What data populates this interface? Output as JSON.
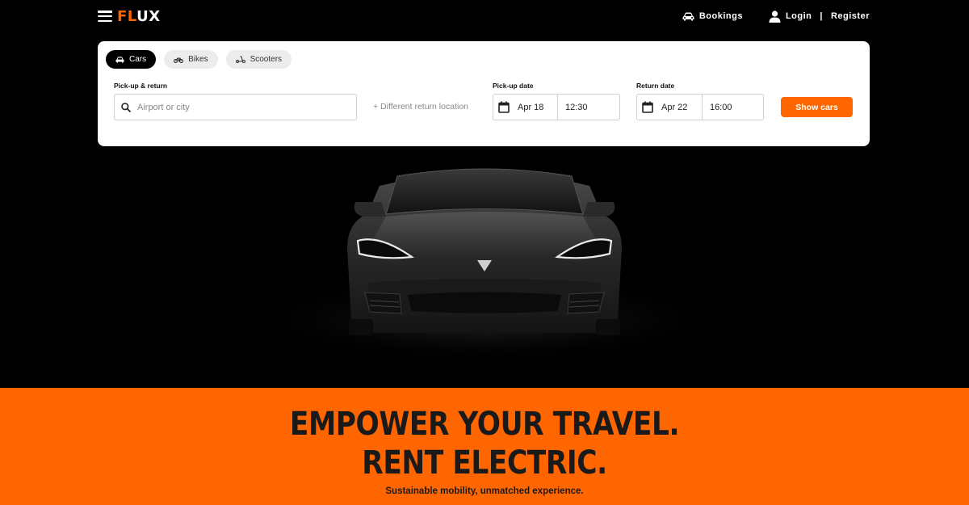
{
  "header": {
    "logo": {
      "part1": "FL",
      "part2": "UX"
    },
    "bookings_label": "Bookings",
    "login_label": "Login",
    "separator": "|",
    "register_label": "Register"
  },
  "search": {
    "tabs": [
      {
        "label": "Cars",
        "icon": "car-icon",
        "active": true
      },
      {
        "label": "Bikes",
        "icon": "bike-icon",
        "active": false
      },
      {
        "label": "Scooters",
        "icon": "scooter-icon",
        "active": false
      }
    ],
    "pickup_label": "Pick-up & return",
    "pickup_placeholder": "Airport or city",
    "different_return": "+ Different return location",
    "pickup_date_label": "Pick-up date",
    "pickup_date": "Apr 18",
    "pickup_time": "12:30",
    "return_date_label": "Return date",
    "return_date": "Apr 22",
    "return_time": "16:00",
    "submit_label": "Show cars"
  },
  "banner": {
    "headline_line1": "EMPOWER YOUR TRAVEL.",
    "headline_line2": "RENT ELECTRIC.",
    "subline": "Sustainable mobility, unmatched experience."
  },
  "colors": {
    "accent": "#ff6600",
    "background": "#000000",
    "card": "#ffffff"
  }
}
